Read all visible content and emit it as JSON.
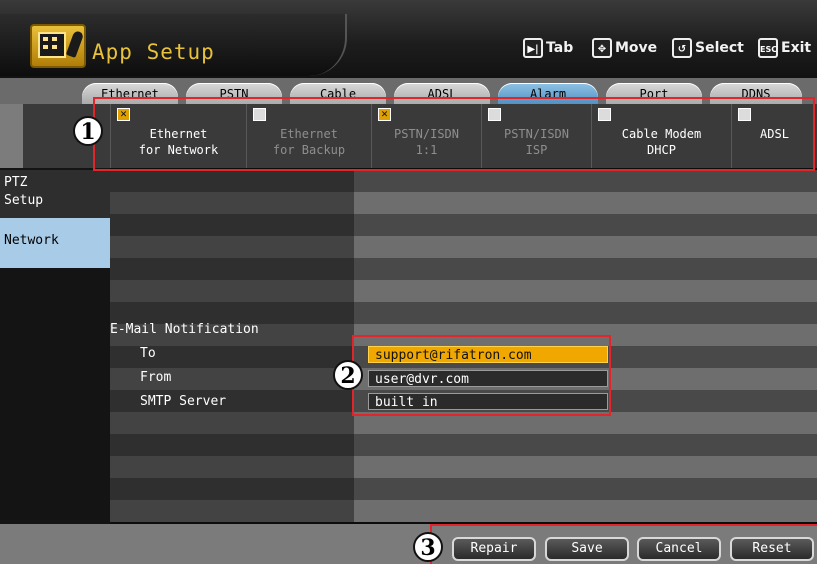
{
  "header": {
    "title": "App Setup",
    "help": [
      {
        "key": "▶|",
        "label": "Tab"
      },
      {
        "key": "✥",
        "label": "Move"
      },
      {
        "key": "↺",
        "label": "Select"
      },
      {
        "key": "ESC",
        "label": "Exit"
      }
    ]
  },
  "tabs": [
    "Ethernet",
    "PSTN",
    "Cable",
    "ADSL",
    "Alarm",
    "Port",
    "DDNS"
  ],
  "active_tab": "Alarm",
  "options": [
    {
      "label": "Ethernet\nfor Network",
      "checked": true,
      "enabled": true
    },
    {
      "label": "Ethernet\nfor Backup",
      "checked": false,
      "enabled": false
    },
    {
      "label": "PSTN/ISDN\n1:1",
      "checked": true,
      "enabled": false
    },
    {
      "label": "PSTN/ISDN\nISP",
      "checked": false,
      "enabled": false
    },
    {
      "label": "Cable Modem\nDHCP",
      "checked": false,
      "enabled": true
    },
    {
      "label": "ADSL",
      "checked": false,
      "enabled": true
    }
  ],
  "sidebar": {
    "items": [
      {
        "label": "PTZ\nSetup",
        "selected": false
      },
      {
        "label": "Network",
        "selected": true
      }
    ]
  },
  "email": {
    "section": "E-Mail Notification",
    "to_label": "To",
    "to_value": "support@rifatron.com",
    "from_label": "From",
    "from_value": "user@dvr.com",
    "smtp_label": "SMTP Server",
    "smtp_value": "built in"
  },
  "buttons": {
    "repair": "Repair",
    "save": "Save",
    "cancel": "Cancel",
    "reset": "Reset"
  },
  "markers": [
    "1",
    "2",
    "3"
  ],
  "colors": {
    "title": "#e8c23a",
    "active_tab": "#8fc3e6",
    "highlight": "#f0a800",
    "annotation": "#e0262a"
  }
}
